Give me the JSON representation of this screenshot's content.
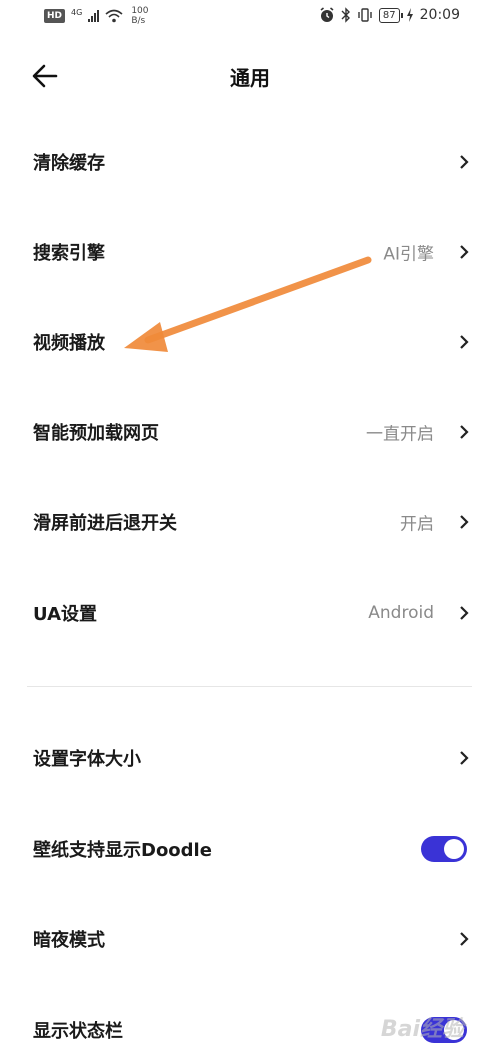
{
  "status_bar": {
    "hd": "HD",
    "network": "4G",
    "speed_value": "100",
    "speed_unit": "B/s",
    "battery": "87",
    "time": "20:09"
  },
  "header": {
    "title": "通用"
  },
  "settings": [
    {
      "label": "清除缓存",
      "value": ""
    },
    {
      "label": "搜索引擎",
      "value": "AI引擎"
    },
    {
      "label": "视频播放",
      "value": ""
    },
    {
      "label": "智能预加载网页",
      "value": "一直开启"
    },
    {
      "label": "滑屏前进后退开关",
      "value": "开启"
    },
    {
      "label": "UA设置",
      "value": "Android"
    },
    {
      "label": "设置字体大小",
      "value": ""
    },
    {
      "label": "壁纸支持显示Doodle",
      "value": ""
    },
    {
      "label": "暗夜模式",
      "value": ""
    },
    {
      "label": "显示状态栏",
      "value": ""
    }
  ],
  "toggles": {
    "wallpaper_doodle": "on",
    "show_status_bar": "on"
  },
  "colors": {
    "accent": "#3a33d6",
    "annotation_arrow": "#f08a3a"
  },
  "watermark": "Bai经验"
}
